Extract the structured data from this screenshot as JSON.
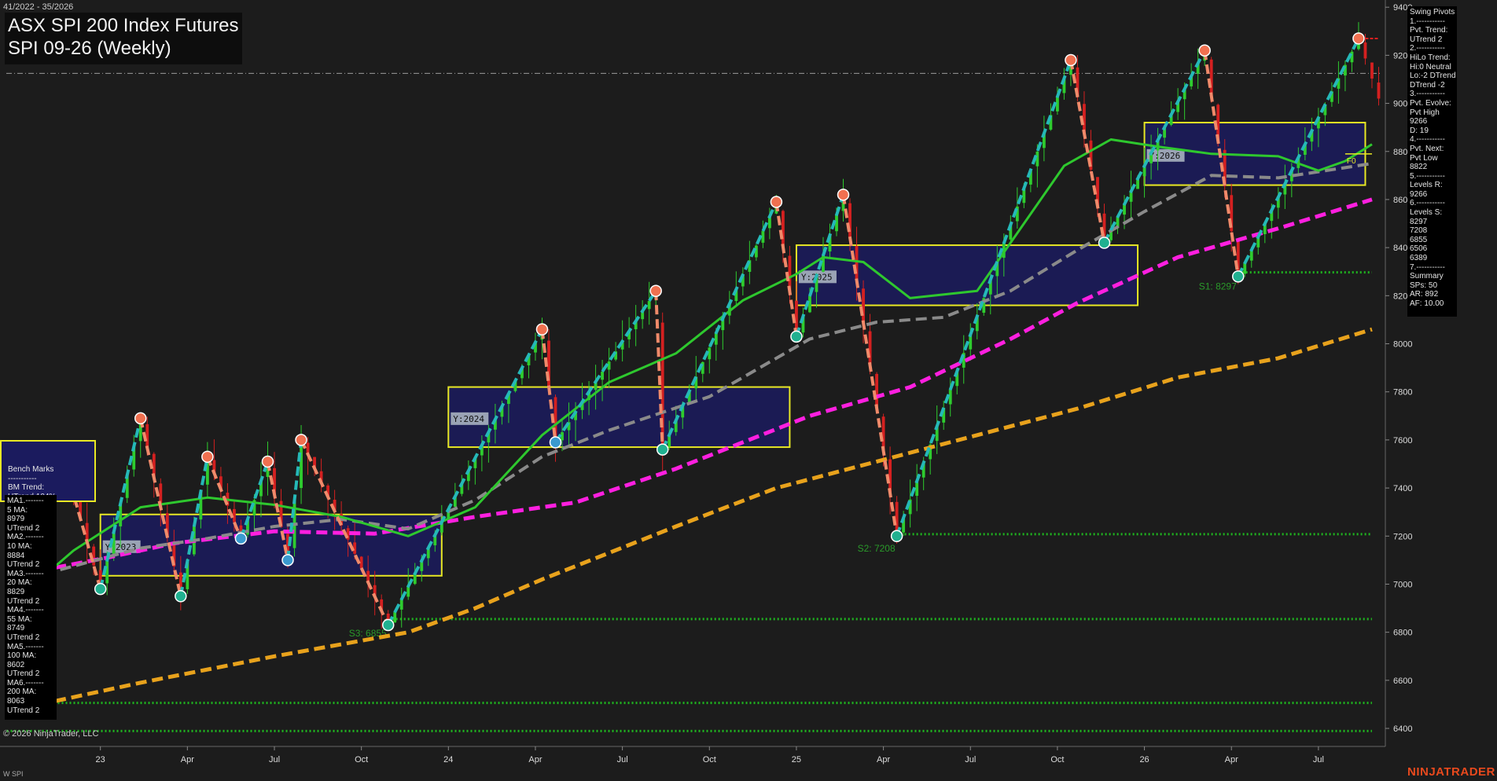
{
  "header": {
    "date_range": "41/2022 - 35/2026",
    "title": "ASX SPI 200 Index Futures",
    "subtitle": "SPI 09-26 (Weekly)"
  },
  "footer": {
    "copyright": "© 2026 NinjaTrader, LLC",
    "instrument_tag": "W SPI",
    "brand": "NINJATRADER"
  },
  "swing_panel": [
    "Swing Pivots",
    "1.-----------",
    "Pvt. Trend:",
    "UTrend 2",
    "2.-----------",
    "HiLo Trend:",
    "Hi:0 Neutral",
    "Lo:-2 DTrend",
    "DTrend -2",
    "3.-----------",
    "Pvt. Evolve:",
    "Pvt High",
    "9266",
    "D: 19",
    "4.-----------",
    "Pvt. Next:",
    "Pvt Low",
    "8822",
    "5.-----------",
    "Levels R:",
    "9266",
    "6.-----------",
    "Levels S:",
    "8297",
    "7208",
    "6855",
    "6506",
    "6389",
    "7.-----------",
    "Summary",
    "SPs: 50",
    "AR: 892",
    "AF: 10.00"
  ],
  "bench_panel": [
    "Bench Marks",
    "-----------",
    "BM Trend:",
    "UTrend 104%"
  ],
  "ma_panel": [
    "MA1.-------",
    "5 MA:",
    "8979",
    "UTrend 2",
    "MA2.-------",
    "10 MA:",
    "8884",
    "UTrend 2",
    "MA3.-------",
    "20 MA:",
    "8829",
    "UTrend 2",
    "MA4.-------",
    "55 MA:",
    "8749",
    "UTrend 2",
    "MA5.-------",
    "100 MA:",
    "8602",
    "UTrend 2",
    "MA6.-------",
    "200 MA:",
    "8063",
    "UTrend 2"
  ],
  "chart_data": {
    "type": "candlestick",
    "instrument": "SPI 09-26",
    "timeframe": "Weekly",
    "y_ticks": [
      6400,
      6600,
      6800,
      7000,
      7200,
      7400,
      7600,
      7800,
      8000,
      8200,
      8400,
      8600,
      8800,
      9000,
      9200,
      9400
    ],
    "ylim": [
      6325,
      9430
    ],
    "x_ticks": [
      {
        "label": "23",
        "x": 14
      },
      {
        "label": "Apr",
        "x": 27
      },
      {
        "label": "Jul",
        "x": 40
      },
      {
        "label": "Oct",
        "x": 53
      },
      {
        "label": "24",
        "x": 66
      },
      {
        "label": "Apr",
        "x": 79
      },
      {
        "label": "Jul",
        "x": 92
      },
      {
        "label": "Oct",
        "x": 105
      },
      {
        "label": "25",
        "x": 118
      },
      {
        "label": "Apr",
        "x": 131
      },
      {
        "label": "Jul",
        "x": 144
      },
      {
        "label": "Oct",
        "x": 157
      },
      {
        "label": "26",
        "x": 170
      },
      {
        "label": "Apr",
        "x": 183
      },
      {
        "label": "Jul",
        "x": 196
      }
    ],
    "xlim": [
      -1,
      206
    ],
    "price_path": [
      [
        0,
        7000
      ],
      [
        9,
        7470
      ],
      [
        14,
        6980
      ],
      [
        20,
        7690
      ],
      [
        26,
        6950
      ],
      [
        30,
        7530
      ],
      [
        35,
        7190
      ],
      [
        39,
        7510
      ],
      [
        42,
        7100
      ],
      [
        44,
        7600
      ],
      [
        57,
        6830
      ],
      [
        80,
        8060
      ],
      [
        82,
        7590
      ],
      [
        97,
        8220
      ],
      [
        98,
        7560
      ],
      [
        115,
        8590
      ],
      [
        118,
        8030
      ],
      [
        125,
        8620
      ],
      [
        133,
        7200
      ],
      [
        159,
        9180
      ],
      [
        164,
        8420
      ],
      [
        179,
        9220
      ],
      [
        184,
        8280
      ],
      [
        202,
        9270
      ],
      [
        205,
        9020
      ]
    ],
    "swing_pivots": [
      {
        "x": 9,
        "price": 7470,
        "type": "high",
        "color": "#c060b0"
      },
      {
        "x": 14,
        "price": 6980,
        "type": "low"
      },
      {
        "x": 20,
        "price": 7690,
        "type": "high"
      },
      {
        "x": 26,
        "price": 6950,
        "type": "low"
      },
      {
        "x": 30,
        "price": 7530,
        "type": "high"
      },
      {
        "x": 35,
        "price": 7190,
        "type": "low",
        "color": "#3a9ad0"
      },
      {
        "x": 39,
        "price": 7510,
        "type": "high"
      },
      {
        "x": 42,
        "price": 7100,
        "type": "low",
        "color": "#3a9ad0"
      },
      {
        "x": 44,
        "price": 7600,
        "type": "high"
      },
      {
        "x": 57,
        "price": 6830,
        "type": "low"
      },
      {
        "x": 80,
        "price": 8060,
        "type": "high"
      },
      {
        "x": 82,
        "price": 7590,
        "type": "low",
        "color": "#3a9ad0"
      },
      {
        "x": 97,
        "price": 8220,
        "type": "high"
      },
      {
        "x": 98,
        "price": 7560,
        "type": "low"
      },
      {
        "x": 115,
        "price": 8590,
        "type": "high"
      },
      {
        "x": 118,
        "price": 8030,
        "type": "low"
      },
      {
        "x": 125,
        "price": 8620,
        "type": "high"
      },
      {
        "x": 133,
        "price": 7200,
        "type": "low"
      },
      {
        "x": 159,
        "price": 9180,
        "type": "high"
      },
      {
        "x": 164,
        "price": 8420,
        "type": "low"
      },
      {
        "x": 179,
        "price": 9220,
        "type": "high"
      },
      {
        "x": 184,
        "price": 8280,
        "type": "low"
      },
      {
        "x": 202,
        "price": 9270,
        "type": "high"
      }
    ],
    "year_boxes": [
      {
        "label": "Y:2023",
        "x0": 14,
        "x1": 65,
        "y_low": 7035,
        "y_high": 7290
      },
      {
        "label": "Y:2024",
        "x0": 66,
        "x1": 117,
        "y_low": 7570,
        "y_high": 7820
      },
      {
        "label": "Y:2025",
        "x0": 118,
        "x1": 169,
        "y_low": 8160,
        "y_high": 8410
      },
      {
        "label": "Y:2026",
        "x0": 170,
        "x1": 203,
        "y_low": 8660,
        "y_high": 8920
      }
    ],
    "bench_box": {
      "x0": -1,
      "x1": 13,
      "y_low": 7330,
      "y_high": 7600
    },
    "moving_averages": [
      {
        "name": "200 MA",
        "color": "#e8a21c",
        "dashed": true,
        "width": 5,
        "points": [
          [
            0,
            6470
          ],
          [
            20,
            6590
          ],
          [
            40,
            6700
          ],
          [
            60,
            6800
          ],
          [
            70,
            6900
          ],
          [
            80,
            7020
          ],
          [
            100,
            7240
          ],
          [
            115,
            7400
          ],
          [
            130,
            7510
          ],
          [
            145,
            7620
          ],
          [
            160,
            7730
          ],
          [
            175,
            7860
          ],
          [
            190,
            7940
          ],
          [
            204,
            8060
          ]
        ]
      },
      {
        "name": "100 MA",
        "color": "#ff1fe0",
        "dashed": true,
        "width": 5,
        "points": [
          [
            0,
            7030
          ],
          [
            15,
            7110
          ],
          [
            25,
            7170
          ],
          [
            40,
            7220
          ],
          [
            55,
            7210
          ],
          [
            70,
            7280
          ],
          [
            85,
            7340
          ],
          [
            100,
            7480
          ],
          [
            120,
            7700
          ],
          [
            135,
            7820
          ],
          [
            150,
            8020
          ],
          [
            160,
            8170
          ],
          [
            175,
            8360
          ],
          [
            190,
            8480
          ],
          [
            204,
            8600
          ]
        ]
      },
      {
        "name": "55 MA",
        "color": "#8a8a8a",
        "dashed": true,
        "width": 4,
        "points": [
          [
            8,
            7060
          ],
          [
            20,
            7150
          ],
          [
            30,
            7190
          ],
          [
            40,
            7240
          ],
          [
            50,
            7270
          ],
          [
            60,
            7230
          ],
          [
            70,
            7350
          ],
          [
            80,
            7530
          ],
          [
            90,
            7640
          ],
          [
            105,
            7780
          ],
          [
            120,
            8020
          ],
          [
            130,
            8090
          ],
          [
            140,
            8110
          ],
          [
            150,
            8220
          ],
          [
            160,
            8390
          ],
          [
            170,
            8550
          ],
          [
            180,
            8700
          ],
          [
            190,
            8690
          ],
          [
            204,
            8750
          ]
        ]
      },
      {
        "name": "20 MA",
        "color": "#2ec82e",
        "dashed": false,
        "width": 3,
        "points": [
          [
            0,
            6900
          ],
          [
            10,
            7140
          ],
          [
            20,
            7320
          ],
          [
            30,
            7360
          ],
          [
            40,
            7330
          ],
          [
            50,
            7280
          ],
          [
            60,
            7200
          ],
          [
            70,
            7320
          ],
          [
            80,
            7620
          ],
          [
            90,
            7840
          ],
          [
            100,
            7960
          ],
          [
            110,
            8180
          ],
          [
            118,
            8290
          ],
          [
            122,
            8360
          ],
          [
            128,
            8340
          ],
          [
            135,
            8190
          ],
          [
            145,
            8220
          ],
          [
            150,
            8420
          ],
          [
            158,
            8740
          ],
          [
            165,
            8850
          ],
          [
            172,
            8820
          ],
          [
            180,
            8790
          ],
          [
            190,
            8780
          ],
          [
            196,
            8720
          ],
          [
            200,
            8760
          ],
          [
            204,
            8830
          ]
        ]
      }
    ],
    "support_levels": [
      {
        "label": "S1: 8297",
        "price": 8297,
        "x0": 184
      },
      {
        "label": "S2: 7208",
        "price": 7208,
        "x0": 133
      },
      {
        "label": "S3: 6855",
        "price": 6855,
        "x0": 57
      },
      {
        "price": 6506,
        "x0": 0
      },
      {
        "price": 6389,
        "x0": 0
      }
    ],
    "ref_line": 9125,
    "last_price": 9270,
    "fib_label": "F0",
    "fib_price": 8790,
    "colors": {
      "bull": "#2ecc2e",
      "bear": "#d42020",
      "pivot_high": "#f07050",
      "pivot_low": "#20b090",
      "up_leg": "#25b8b8",
      "down_leg": "#f08a6a"
    }
  }
}
